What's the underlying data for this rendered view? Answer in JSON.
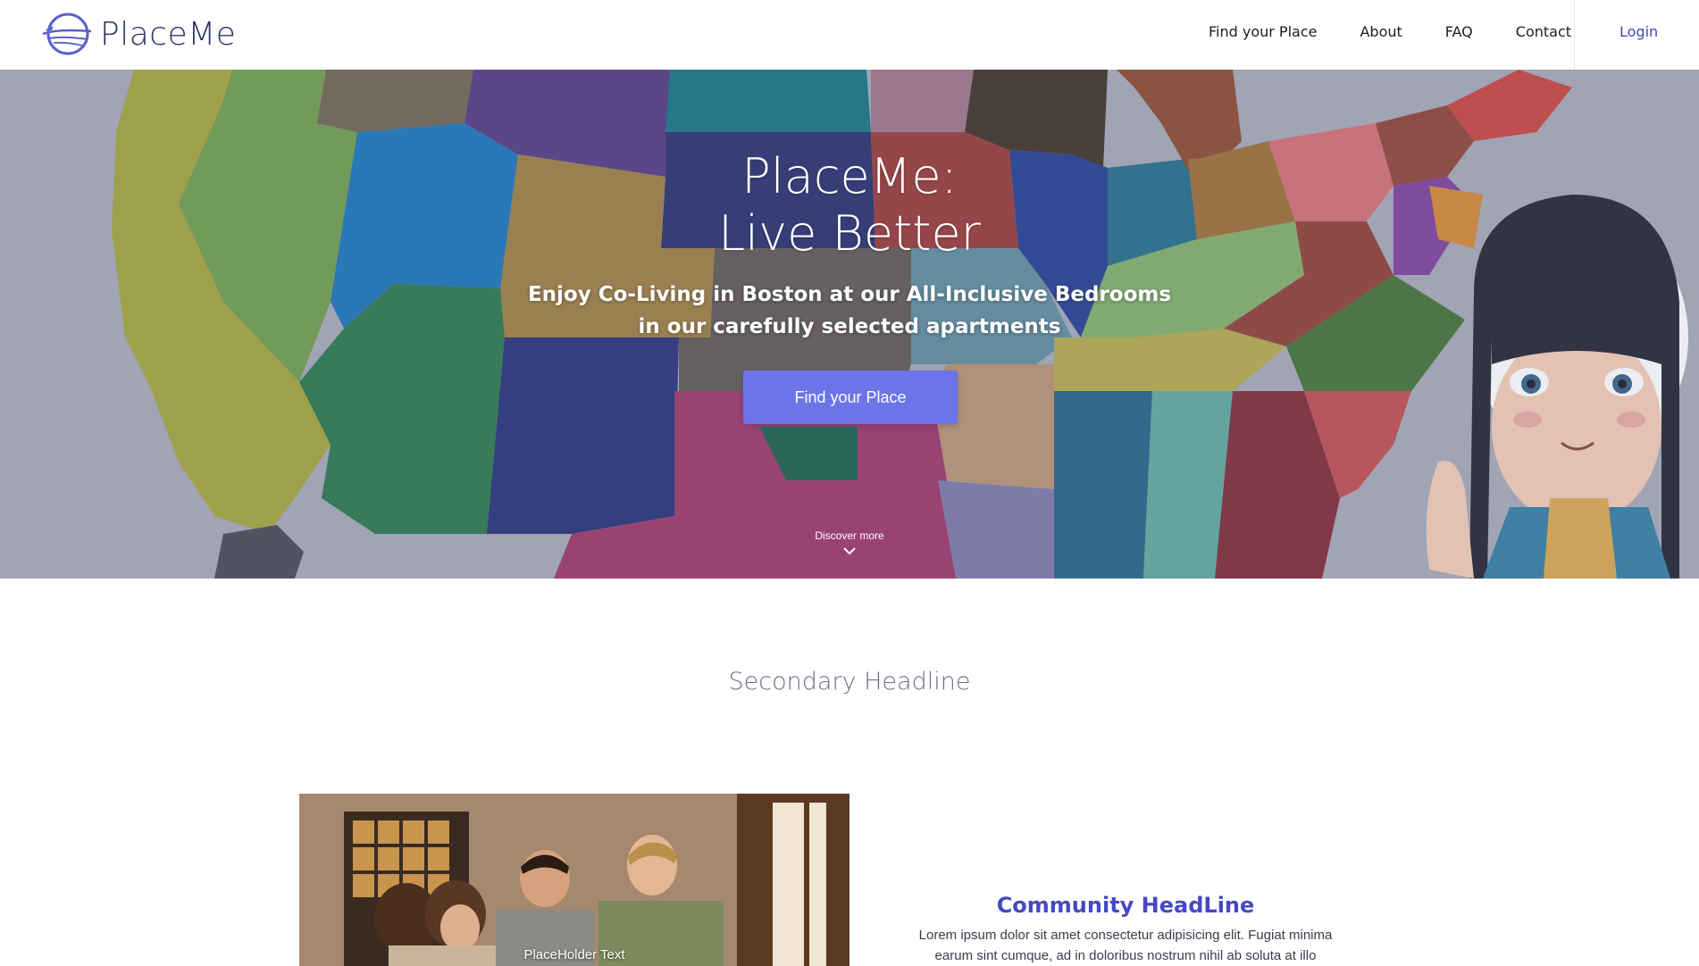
{
  "brand": {
    "name": "PlaceMe",
    "logo_icon": "globe-plane-icon",
    "accent": "#4447b8"
  },
  "nav": {
    "items": [
      {
        "label": "Find your Place"
      },
      {
        "label": "About"
      },
      {
        "label": "FAQ"
      },
      {
        "label": "Contact"
      }
    ],
    "login_label": "Login"
  },
  "hero": {
    "title_line1": "PlaceMe:",
    "title_line2": "Live Better",
    "subtitle_line1": "Enjoy Co-Living in Boston at our All-Inclusive Bedrooms",
    "subtitle_line2": "in our carefully selected apartments",
    "cta_label": "Find your Place",
    "cta_color": "#6b74e8",
    "discover_label": "Discover more"
  },
  "secondary": {
    "headline": "Secondary Headline"
  },
  "feature": {
    "image_caption": "PlaceHolder Text",
    "title": "Community HeadLine",
    "title_color": "#4548c4",
    "text_line1": "Lorem ipsum dolor sit amet consectetur adipisicing elit. Fugiat minima",
    "text_line2": "earum sint cumque, ad in doloribus nostrum nihil ab soluta at illo"
  }
}
